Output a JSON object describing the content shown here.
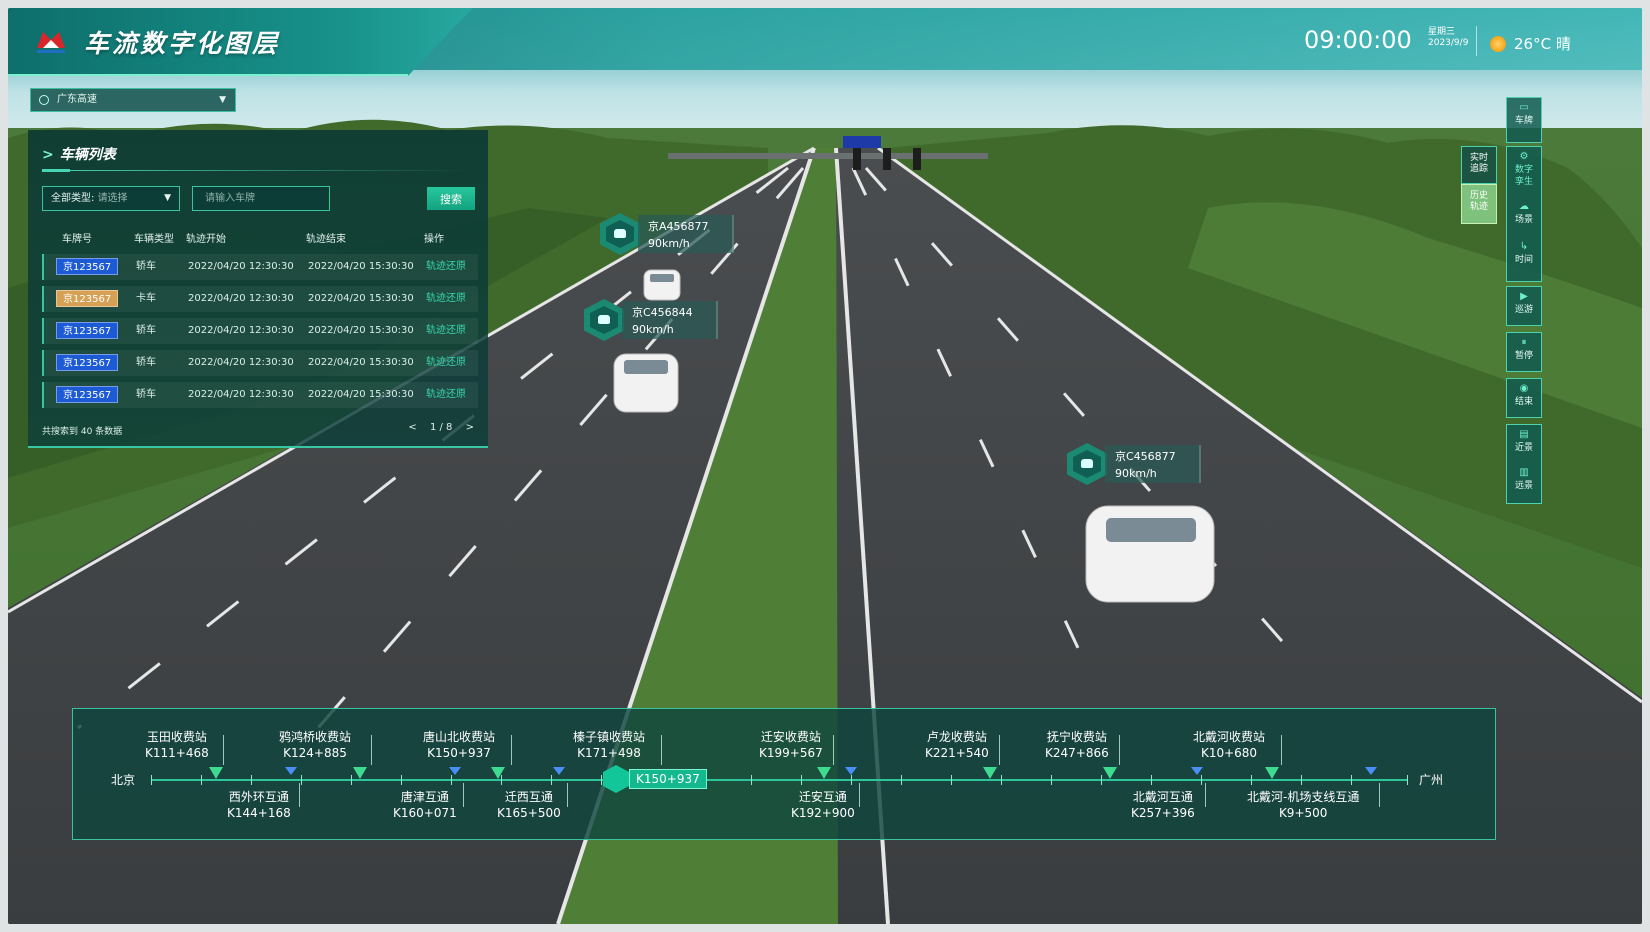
{
  "header": {
    "title": "车流数字化图层",
    "time": "09:00:00",
    "weekday": "星期三",
    "date": "2023/9/9",
    "weather": "26°C 晴"
  },
  "region_select": {
    "value": "广东高速"
  },
  "vehicle_list": {
    "title": "车辆列表",
    "type_filter": {
      "label": "全部类型:",
      "placeholder": "请选择"
    },
    "plate_input_placeholder": "请输入车牌",
    "search_label": "搜索",
    "columns": [
      "车牌号",
      "车辆类型",
      "轨迹开始",
      "轨迹结束",
      "操作"
    ],
    "rows": [
      {
        "plate": "京123567",
        "plate_color": "blue",
        "type": "轿车",
        "start": "2022/04/20 12:30:30",
        "end": "2022/04/20 15:30:30",
        "action": "轨迹还原"
      },
      {
        "plate": "京123567",
        "plate_color": "yellow",
        "type": "卡车",
        "start": "2022/04/20 12:30:30",
        "end": "2022/04/20 15:30:30",
        "action": "轨迹还原"
      },
      {
        "plate": "京123567",
        "plate_color": "blue",
        "type": "轿车",
        "start": "2022/04/20 12:30:30",
        "end": "2022/04/20 15:30:30",
        "action": "轨迹还原"
      },
      {
        "plate": "京123567",
        "plate_color": "blue",
        "type": "轿车",
        "start": "2022/04/20 12:30:30",
        "end": "2022/04/20 15:30:30",
        "action": "轨迹还原"
      },
      {
        "plate": "京123567",
        "plate_color": "blue",
        "type": "轿车",
        "start": "2022/04/20 12:30:30",
        "end": "2022/04/20 15:30:30",
        "action": "轨迹还原"
      }
    ],
    "footer": "共搜索到 40 条数据",
    "pager": {
      "prev": "<",
      "page": "1 / 8",
      "next": ">"
    }
  },
  "vehicle_labels": [
    {
      "plate": "京A456877",
      "speed": "90km/h"
    },
    {
      "plate": "京C456844",
      "speed": "90km/h"
    },
    {
      "plate": "京C456877",
      "speed": "90km/h"
    }
  ],
  "right_toolbar": {
    "plate": "车牌",
    "realtime_track": "实时追踪",
    "history_track": "历史轨迹",
    "digital_twin": "数字孪生",
    "scene": "场景",
    "time": "时间",
    "tour": "巡游",
    "pause": "暂停",
    "end": "结束",
    "near_view": "近景",
    "far_view": "远景"
  },
  "route": {
    "start": "北京",
    "end": "广州",
    "current": "K150+937",
    "top_stations": [
      {
        "name": "玉田收费站",
        "km": "K111+468"
      },
      {
        "name": "鸦鸿桥收费站",
        "km": "K124+885"
      },
      {
        "name": "唐山北收费站",
        "km": "K150+937"
      },
      {
        "name": "榛子镇收费站",
        "km": "K171+498"
      },
      {
        "name": "迁安收费站",
        "km": "K199+567"
      },
      {
        "name": "卢龙收费站",
        "km": "K221+540"
      },
      {
        "name": "抚宁收费站",
        "km": "K247+866"
      },
      {
        "name": "北戴河收费站",
        "km": "K10+680"
      }
    ],
    "bottom_stations": [
      {
        "name": "西外环互通",
        "km": "K144+168"
      },
      {
        "name": "唐津互通",
        "km": "K160+071"
      },
      {
        "name": "迁西互通",
        "km": "K165+500"
      },
      {
        "name": "迁安互通",
        "km": "K192+900"
      },
      {
        "name": "北戴河互通",
        "km": "K257+396"
      },
      {
        "name": "北戴河-机场支线互通",
        "km": "K9+500"
      }
    ]
  },
  "colors": {
    "accent": "#2ec59a",
    "plate_blue": "#1d5bd6",
    "plate_yellow": "#d6a155"
  }
}
